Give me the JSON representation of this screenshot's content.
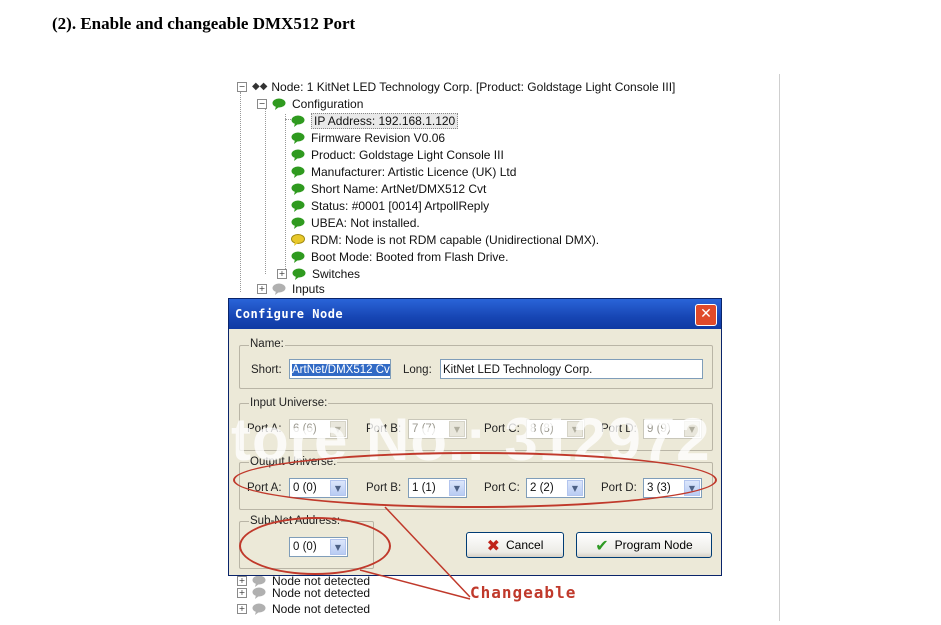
{
  "heading": "(2). Enable and changeable DMX512 Port",
  "tree": {
    "node_label": "Node: 1  KitNet  LED Technology Corp. [Product: Goldstage Light Console III]",
    "configuration": "Configuration",
    "items": [
      "IP Address: 192.168.1.120",
      "Firmware Revision V0.06",
      "Product: Goldstage Light Console III",
      "Manufacturer: Artistic Licence (UK) Ltd",
      "Short Name: ArtNet/DMX512 Cvt",
      "Status: #0001 [0014] ArtpollReply",
      "UBEA: Not installed.",
      "RDM: Node is not RDM capable (Unidirectional DMX).",
      "Boot Mode: Booted from Flash Drive.",
      "Switches"
    ],
    "inputs": "Inputs",
    "bottom_items": [
      "Node not detected",
      "Node not detected",
      "Node not detected"
    ]
  },
  "dialog": {
    "title": "Configure Node",
    "close": "✕",
    "name_group": "Name:",
    "short_label": "Short:",
    "short_value": "ArtNet/DMX512 Cvt",
    "long_label": "Long:",
    "long_value": "KitNet  LED Technology Corp.",
    "input_group": "Input Universe:",
    "input_ports": [
      {
        "label": "Port A:",
        "value": "6 (6)"
      },
      {
        "label": "Port B:",
        "value": "7 (7)"
      },
      {
        "label": "Port C:",
        "value": "8 (8)"
      },
      {
        "label": "Port D:",
        "value": "9 (9)"
      }
    ],
    "output_group": "Output Universe:",
    "output_ports": [
      {
        "label": "Port A:",
        "value": "0 (0)"
      },
      {
        "label": "Port B:",
        "value": "1 (1)"
      },
      {
        "label": "Port C:",
        "value": "2 (2)"
      },
      {
        "label": "Port D:",
        "value": "3 (3)"
      }
    ],
    "subnet_group": "Sub-Net Address:",
    "subnet_value": "0 (0)",
    "cancel": "Cancel",
    "program": "Program Node"
  },
  "watermark": "Store No.: 312972",
  "annotation": "Changeable",
  "colors": {
    "accent_red": "#c0392b",
    "title_blue": "#1746b4",
    "bubble_green": "#2f9a1f"
  }
}
